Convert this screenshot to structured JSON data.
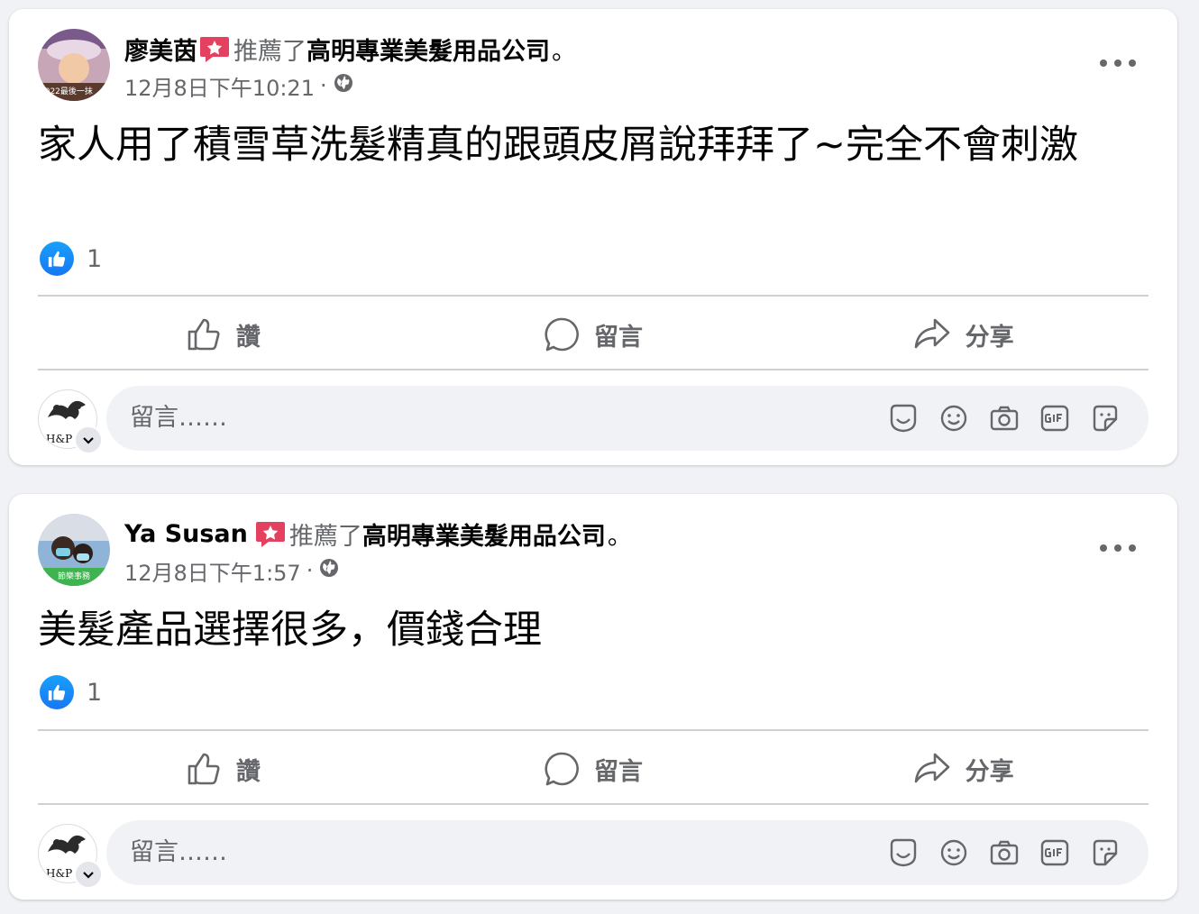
{
  "posts": [
    {
      "author": "廖美茵",
      "verb": "推薦了",
      "page": "高明專業美髮用品公司",
      "end": "。",
      "timestamp": "12月8日下午10:21",
      "separator": "·",
      "text": "家人用了積雪草洗髮精真的跟頭皮屑說拜拜了~完全不會刺激",
      "like_count": "1",
      "avatar_caption": "2022最後一抹"
    },
    {
      "author": "Ya Susan",
      "verb": "推薦了",
      "page": "高明專業美髮用品公司",
      "end": "。",
      "timestamp": "12月8日下午1:57",
      "separator": "·",
      "text": "美髮產品選擇很多，價錢合理",
      "like_count": "1",
      "avatar_caption": "節樂事務"
    }
  ],
  "actions": {
    "like": "讚",
    "comment": "留言",
    "share": "分享"
  },
  "composer": {
    "placeholder": "留言……",
    "avatar_text": "H&P NF"
  },
  "colors": {
    "accent": "#1877f2",
    "secondary_text": "#65676b",
    "badge": "#e4405f"
  }
}
